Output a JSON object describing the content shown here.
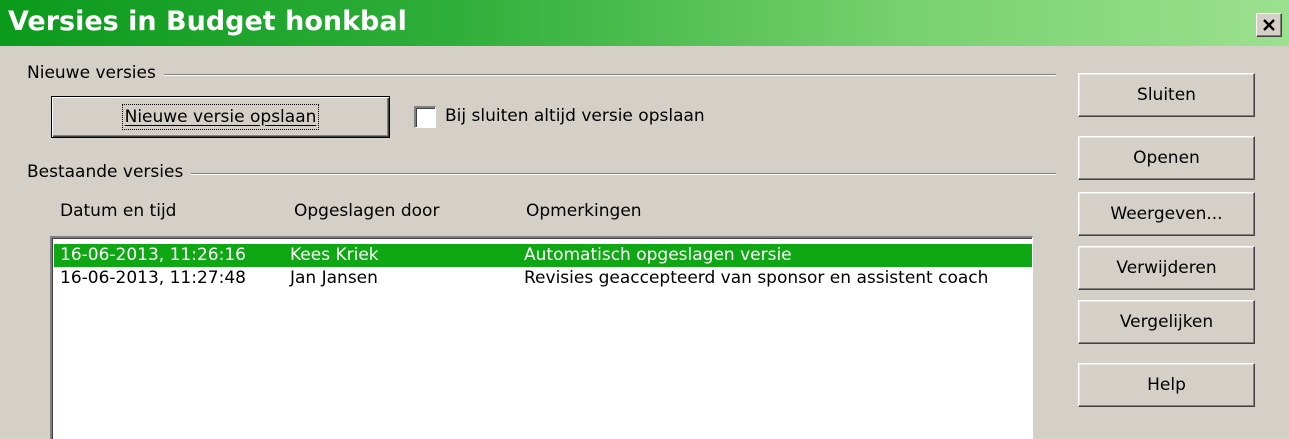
{
  "window": {
    "title": "Versies in Budget honkbal",
    "close_symbol": "×"
  },
  "new_versions": {
    "group_label": "Nieuwe versies",
    "save_button": "Nieuwe versie opslaan",
    "checkbox_label": "Bij sluiten altijd versie opslaan",
    "checkbox_checked": false
  },
  "existing_versions": {
    "group_label": "Bestaande versies",
    "columns": [
      "Datum en tijd",
      "Opgeslagen door",
      "Opmerkingen"
    ],
    "rows": [
      {
        "date": "16-06-2013, 11:26:16",
        "author": "Kees Kriek",
        "comment": "Automatisch opgeslagen versie",
        "selected": true
      },
      {
        "date": "16-06-2013, 11:27:48",
        "author": "Jan Jansen",
        "comment": "Revisies geaccepteerd van sponsor en assistent coach",
        "selected": false
      }
    ]
  },
  "buttons": {
    "close": "Sluiten",
    "open": "Openen",
    "show": "Weergeven...",
    "delete": "Verwijderen",
    "compare": "Vergelijken",
    "help": "Help"
  },
  "colors": {
    "title_gradient_start": "#0b9a1c",
    "title_gradient_end": "#9ce08f",
    "selection": "#0fa814",
    "dialog_bg": "#d4d0c8"
  }
}
